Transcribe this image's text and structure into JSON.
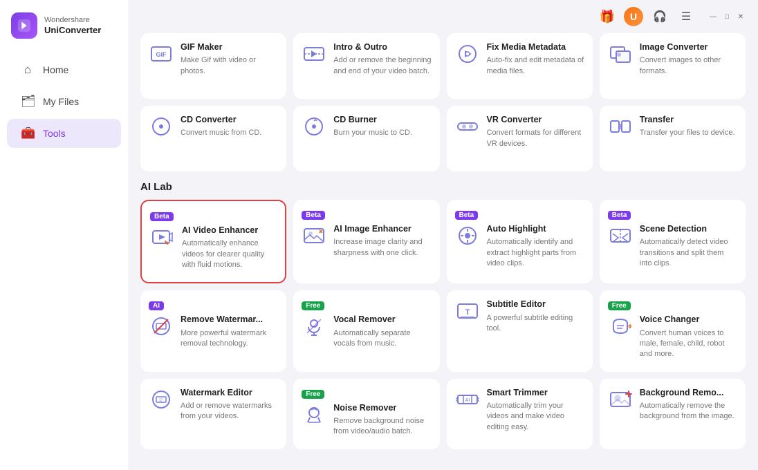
{
  "app": {
    "brand": "Wondershare",
    "product": "UniConverter"
  },
  "nav": {
    "home_label": "Home",
    "myfiles_label": "My Files",
    "tools_label": "Tools"
  },
  "topbar": {
    "gift_icon": "🎁",
    "avatar_label": "U",
    "headset_icon": "🎧",
    "menu_icon": "☰",
    "minimize_icon": "—",
    "maximize_icon": "□",
    "close_icon": "✕"
  },
  "sections": [
    {
      "title": "",
      "cards": [
        {
          "title": "GIF Maker",
          "desc": "Make Gif with video or photos.",
          "badge": "",
          "highlighted": false
        },
        {
          "title": "Intro & Outro",
          "desc": "Add or remove the beginning and end of your video batch.",
          "badge": "",
          "highlighted": false
        },
        {
          "title": "Fix Media Metadata",
          "desc": "Auto-fix and edit metadata of media files.",
          "badge": "",
          "highlighted": false
        },
        {
          "title": "Image Converter",
          "desc": "Convert images to other formats.",
          "badge": "",
          "highlighted": false
        }
      ]
    },
    {
      "title": "",
      "cards": [
        {
          "title": "CD Converter",
          "desc": "Convert music from CD.",
          "badge": "",
          "highlighted": false
        },
        {
          "title": "CD Burner",
          "desc": "Burn your music to CD.",
          "badge": "",
          "highlighted": false
        },
        {
          "title": "VR Converter",
          "desc": "Convert formats for different VR devices.",
          "badge": "",
          "highlighted": false
        },
        {
          "title": "Transfer",
          "desc": "Transfer your files to device.",
          "badge": "",
          "highlighted": false
        }
      ]
    },
    {
      "title": "AI Lab",
      "cards": [
        {
          "title": "AI Video Enhancer",
          "desc": "Automatically enhance videos for clearer quality with fluid motions.",
          "badge": "Beta",
          "badge_type": "beta",
          "highlighted": true
        },
        {
          "title": "AI Image Enhancer",
          "desc": "Increase image clarity and sharpness with one click.",
          "badge": "Beta",
          "badge_type": "beta",
          "highlighted": false
        },
        {
          "title": "Auto Highlight",
          "desc": "Automatically identify and extract highlight parts from video clips.",
          "badge": "Beta",
          "badge_type": "beta",
          "highlighted": false
        },
        {
          "title": "Scene Detection",
          "desc": "Automatically detect video transitions and split them into clips.",
          "badge": "Beta",
          "badge_type": "beta",
          "highlighted": false
        }
      ]
    },
    {
      "title": "",
      "cards": [
        {
          "title": "Remove Watermar...",
          "desc": "More powerful watermark removal technology.",
          "badge": "AI",
          "badge_type": "ai",
          "highlighted": false
        },
        {
          "title": "Vocal Remover",
          "desc": "Automatically separate vocals from music.",
          "badge": "Free",
          "badge_type": "free",
          "highlighted": false
        },
        {
          "title": "Subtitle Editor",
          "desc": "A powerful subtitle editing tool.",
          "badge": "",
          "highlighted": false
        },
        {
          "title": "Voice Changer",
          "desc": "Convert human voices to male, female, child, robot and more.",
          "badge": "Free",
          "badge_type": "free",
          "highlighted": false
        }
      ]
    },
    {
      "title": "",
      "cards": [
        {
          "title": "Watermark Editor",
          "desc": "Add or remove watermarks from your videos.",
          "badge": "",
          "highlighted": false
        },
        {
          "title": "Noise Remover",
          "desc": "Remove background noise from video/audio batch.",
          "badge": "Free",
          "badge_type": "free",
          "highlighted": false
        },
        {
          "title": "Smart Trimmer",
          "desc": "Automatically trim your videos and make video editing easy.",
          "badge": "",
          "highlighted": false
        },
        {
          "title": "Background Remo...",
          "desc": "Automatically remove the background from the image.",
          "badge": "",
          "highlighted": false
        }
      ]
    }
  ]
}
